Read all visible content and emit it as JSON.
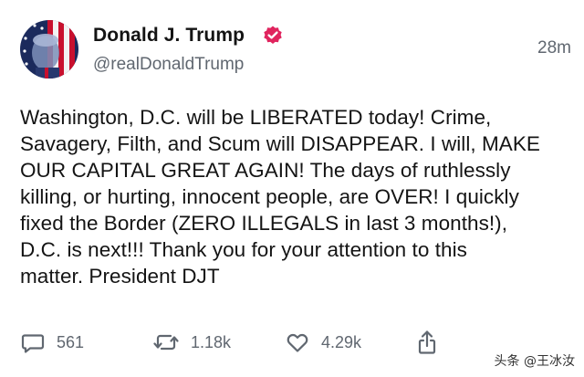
{
  "post": {
    "author": {
      "display_name": "Donald J. Trump",
      "handle": "@realDonaldTrump",
      "verified": true,
      "verified_color": "#e0245e"
    },
    "timestamp": "28m",
    "body": "Washington, D.C. will be LIBERATED today! Crime,\nSavagery, Filth, and Scum will DISAPPEAR. I will, MAKE\nOUR CAPITAL GREAT AGAIN! The days of ruthlessly\nkilling, or hurting, innocent people, are OVER! I quickly\nfixed the Border (ZERO ILLEGALS in last 3 months!),\nD.C. is next!!! Thank you for your attention to this\nmatter. President DJT"
  },
  "actions": {
    "reply": {
      "icon": "comment-icon",
      "count": "561"
    },
    "repost": {
      "icon": "repost-icon",
      "count": "1.18k"
    },
    "like": {
      "icon": "heart-icon",
      "count": "4.29k"
    },
    "share": {
      "icon": "share-icon"
    }
  },
  "watermark": "头条 @王冰汝",
  "colors": {
    "text": "#141414",
    "muted": "#606770",
    "background": "#ffffff"
  }
}
